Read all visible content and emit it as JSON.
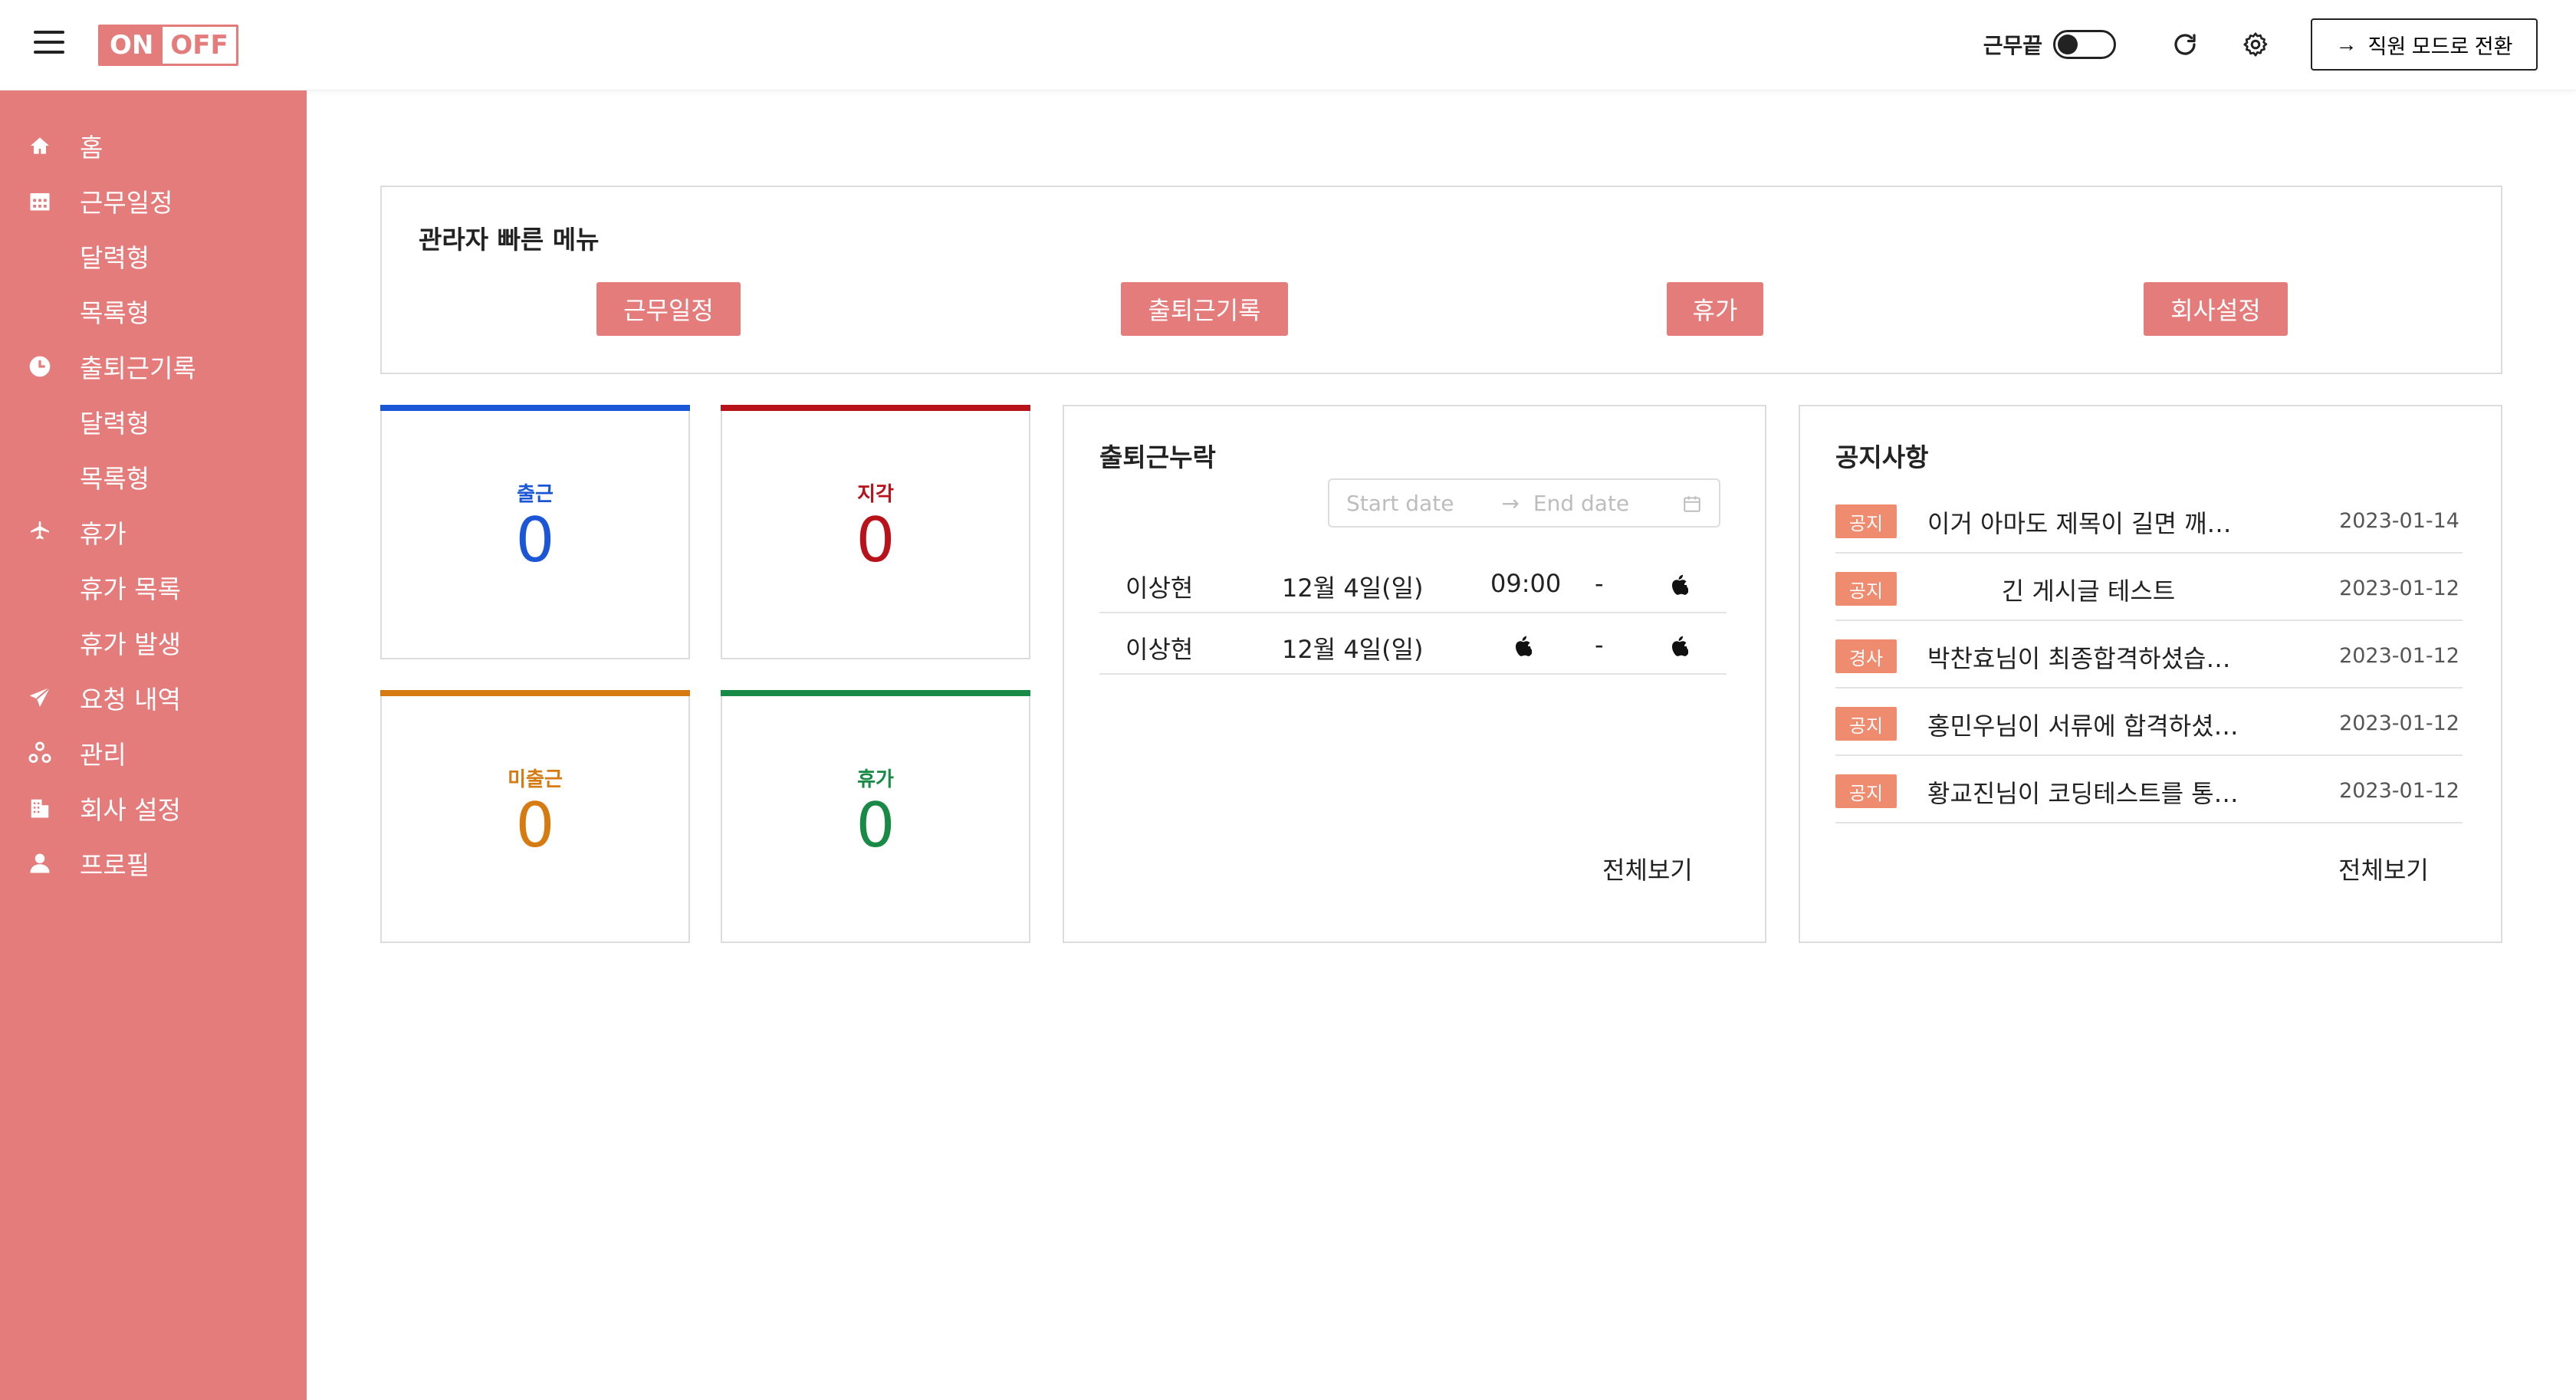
{
  "header": {
    "logo_on": "ON",
    "logo_off": "OFF",
    "toggle_label": "근무끝",
    "mode_button": "직원 모드로 전환"
  },
  "sidebar": {
    "items": [
      {
        "label": "홈",
        "icon": "home-icon"
      },
      {
        "label": "근무일정",
        "icon": "calendar-icon"
      },
      {
        "label": "달력형",
        "icon": ""
      },
      {
        "label": "목록형",
        "icon": ""
      },
      {
        "label": "출퇴근기록",
        "icon": "clock-icon"
      },
      {
        "label": "달력형",
        "icon": ""
      },
      {
        "label": "목록형",
        "icon": ""
      },
      {
        "label": "휴가",
        "icon": "airplane-icon"
      },
      {
        "label": "휴가 목록",
        "icon": ""
      },
      {
        "label": "휴가 발생",
        "icon": ""
      },
      {
        "label": "요청 내역",
        "icon": "send-icon"
      },
      {
        "label": "관리",
        "icon": "cluster-icon"
      },
      {
        "label": "회사 설정",
        "icon": "building-icon"
      },
      {
        "label": "프로필",
        "icon": "user-icon"
      }
    ]
  },
  "quick_menu": {
    "title": "관라자 빠른 메뉴",
    "buttons": [
      "근무일정",
      "출퇴근기록",
      "휴가",
      "회사설정"
    ]
  },
  "stats": [
    {
      "label": "출근",
      "value": "0",
      "color": "#1a56d6"
    },
    {
      "label": "지각",
      "value": "0",
      "color": "#b8121b"
    },
    {
      "label": "미출근",
      "value": "0",
      "color": "#d67a12"
    },
    {
      "label": "휴가",
      "value": "0",
      "color": "#198a45"
    }
  ],
  "attendance": {
    "title": "출퇴근누락",
    "start_placeholder": "Start date",
    "end_placeholder": "End date",
    "rows": [
      {
        "name": "이상현",
        "date": "12월 4일(일)",
        "in": "09:00",
        "dash": "-",
        "out": ""
      },
      {
        "name": "이상현",
        "date": "12월 4일(일)",
        "in": "",
        "dash": "-",
        "out": ""
      }
    ],
    "more": "전체보기"
  },
  "notices": {
    "title": "공지사항",
    "rows": [
      {
        "badge": "공지",
        "title": "이거 아마도 제목이 길면 깨지지 않을까",
        "date": "2023-01-14"
      },
      {
        "badge": "공지",
        "title": "긴 게시글 테스트",
        "date": "2023-01-12"
      },
      {
        "badge": "경사",
        "title": "박찬효님이 최종합격하셨습니다",
        "date": "2023-01-12"
      },
      {
        "badge": "공지",
        "title": "홍민우님이 서류에 합격하셨습니다",
        "date": "2023-01-12"
      },
      {
        "badge": "공지",
        "title": "황교진님이 코딩테스트를 통과하셨습니다",
        "date": "2023-01-12"
      }
    ],
    "more": "전체보기"
  }
}
